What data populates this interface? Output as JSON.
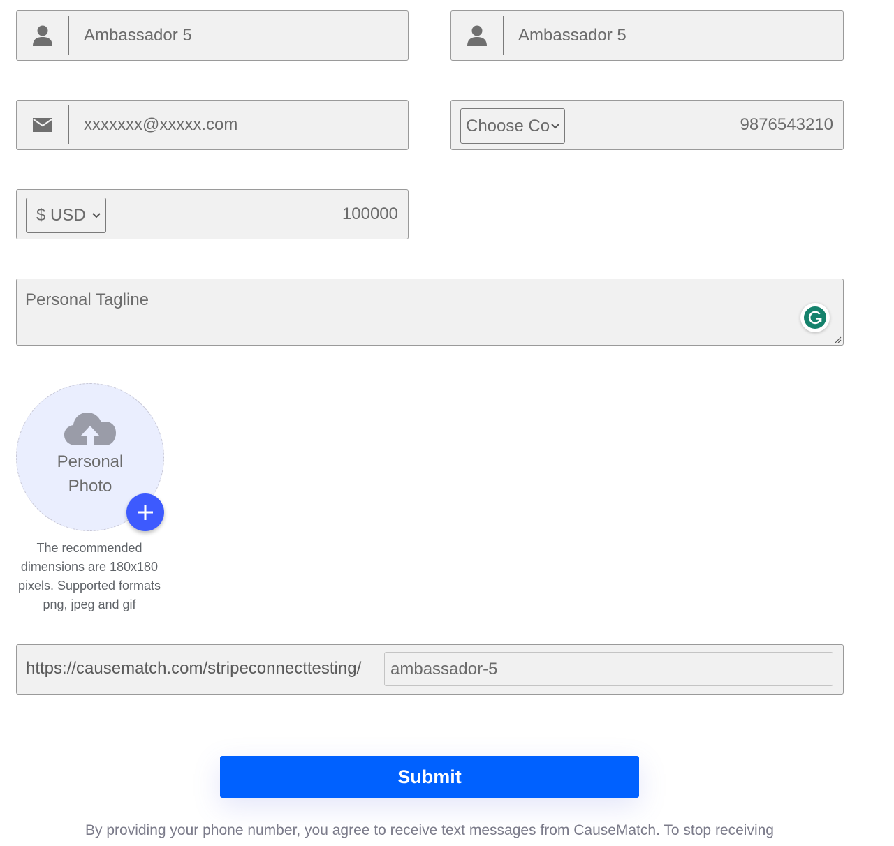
{
  "first_name": {
    "value": "Ambassador 5",
    "icon": "person-icon"
  },
  "last_name": {
    "value": "Ambassador 5",
    "icon": "person-icon"
  },
  "email": {
    "value": "xxxxxxx@xxxxx.com",
    "icon": "envelope-icon"
  },
  "phone": {
    "country_select": "Choose Co",
    "value": "9876543210"
  },
  "goal": {
    "currency_select": "$ USD",
    "amount": "100000"
  },
  "tagline": {
    "placeholder": "Personal Tagline"
  },
  "photo": {
    "label_line1": "Personal",
    "label_line2": "Photo",
    "hint": "The recommended dimensions are 180x180 pixels. Supported formats png, jpeg and gif",
    "icon": "cloud-upload-icon"
  },
  "url": {
    "prefix": "https://causematch.com/stripeconnecttesting/",
    "slug": "ambassador-5"
  },
  "submit_label": "Submit",
  "disclaimer": "By providing your phone number, you agree to receive text messages from CauseMatch. To stop receiving",
  "colors": {
    "accent": "#0061ff",
    "plus_button": "#3d5afe",
    "grammarly": "#15826c"
  }
}
